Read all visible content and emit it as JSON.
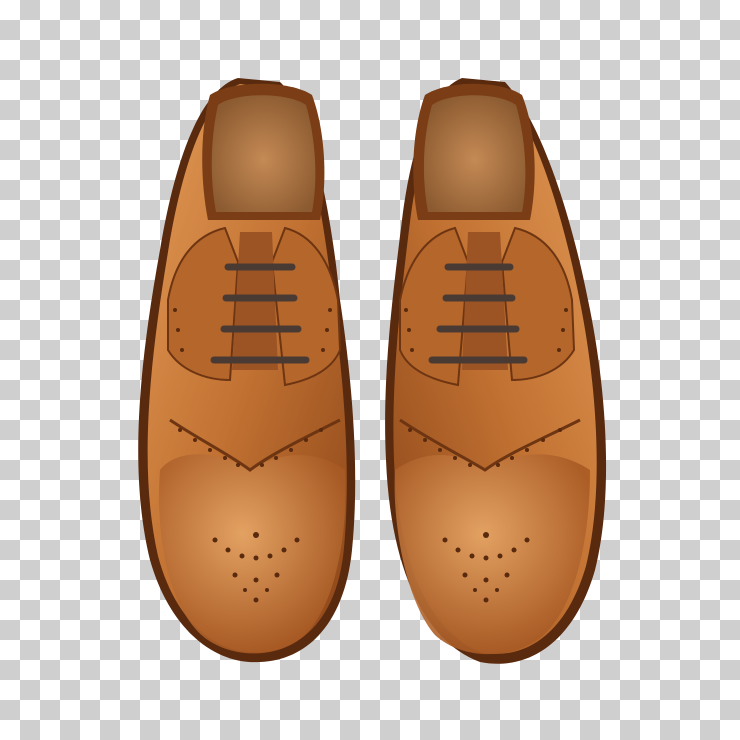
{
  "image": {
    "subject": "pair-of-brown-leather-wingtip-brogue-shoes",
    "background": "transparency-checkerboard",
    "colors": {
      "checker_light": "#ffffff",
      "checker_dark": "#cfcfcf",
      "leather_light": "#d98a4a",
      "leather_mid": "#b8682d",
      "leather_dark": "#7a3d15",
      "sole": "#5a2a0e",
      "lining": "#c58a55",
      "lace": "#4a3a34"
    }
  }
}
